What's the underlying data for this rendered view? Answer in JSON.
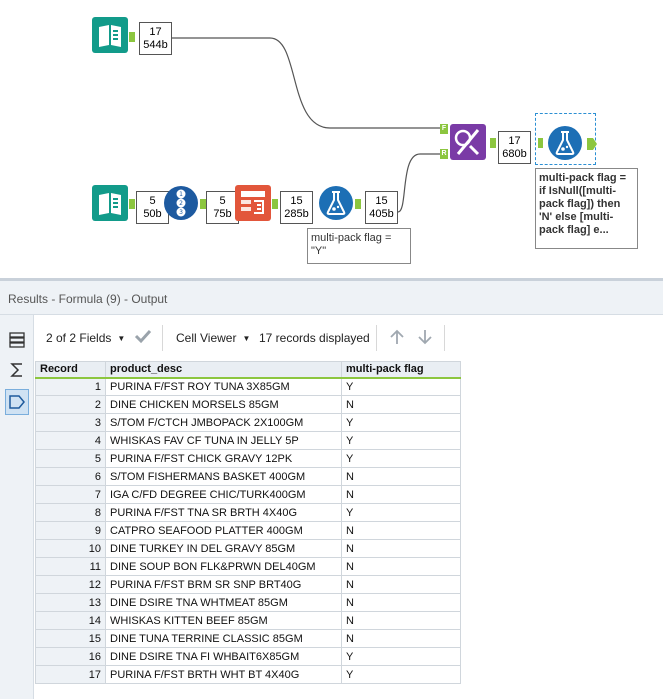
{
  "workflow": {
    "count_boxes": [
      {
        "name": "count-input1",
        "records": "17",
        "bytes": "544b"
      },
      {
        "name": "count-input2",
        "records": "5",
        "bytes": "50b"
      },
      {
        "name": "count-recordid",
        "records": "5",
        "bytes": "75b"
      },
      {
        "name": "count-generate",
        "records": "15",
        "bytes": "285b"
      },
      {
        "name": "count-formula-y",
        "records": "15",
        "bytes": "405b"
      },
      {
        "name": "count-join",
        "records": "17",
        "bytes": "680b"
      }
    ],
    "anchors": {
      "left": "F",
      "right": "R"
    },
    "annotations": {
      "formula_y": "multi-pack flag =\n\"Y\"",
      "formula_9": "multi-pack flag =\nif IsNull([multi-\npack flag]) then\n'N' else [multi-\npack flag] e..."
    },
    "colors": {
      "input": "#129b8a",
      "recordid": "#1d5aa0",
      "generate": "#e2563b",
      "formula": "#1d6fb5",
      "join": "#7a3ba6",
      "anchor": "#8cc63f"
    }
  },
  "results": {
    "title": "Results - Formula (9) - Output",
    "toolbar": {
      "fields": "2 of 2 Fields",
      "viewer": "Cell Viewer",
      "records_displayed": "17 records displayed"
    },
    "columns": [
      "Record",
      "product_desc",
      "multi-pack flag"
    ],
    "rows": [
      [
        "1",
        "PURINA F/FST ROY TUNA 3X85GM",
        "Y"
      ],
      [
        "2",
        "DINE CHICKEN MORSELS 85GM",
        "N"
      ],
      [
        "3",
        "S/TOM F/CTCH JMBOPACK 2X100GM",
        "Y"
      ],
      [
        "4",
        "WHISKAS FAV CF TUNA IN JELLY 5P",
        "Y"
      ],
      [
        "5",
        "PURINA F/FST CHICK GRAVY 12PK",
        "Y"
      ],
      [
        "6",
        "S/TOM FISHERMANS BASKET 400GM",
        "N"
      ],
      [
        "7",
        "IGA C/FD DEGREE CHIC/TURK400GM",
        "N"
      ],
      [
        "8",
        "PURINA F/FST TNA SR BRTH 4X40G",
        "Y"
      ],
      [
        "9",
        "CATPRO SEAFOOD PLATTER 400GM",
        "N"
      ],
      [
        "10",
        "DINE TURKEY IN DEL GRAVY 85GM",
        "N"
      ],
      [
        "11",
        "DINE SOUP BON FLK&PRWN DEL40GM",
        "N"
      ],
      [
        "12",
        "PURINA F/FST BRM SR SNP BRT40G",
        "N"
      ],
      [
        "13",
        "DINE DSIRE TNA WHTMEAT 85GM",
        "N"
      ],
      [
        "14",
        "WHISKAS KITTEN BEEF 85GM",
        "N"
      ],
      [
        "15",
        "DINE TUNA TERRINE CLASSIC 85GM",
        "N"
      ],
      [
        "16",
        "DINE DSIRE TNA FI WHBAIT6X85GM",
        "Y"
      ],
      [
        "17",
        "PURINA F/FST BRTH WHT BT 4X40G",
        "Y"
      ]
    ]
  }
}
